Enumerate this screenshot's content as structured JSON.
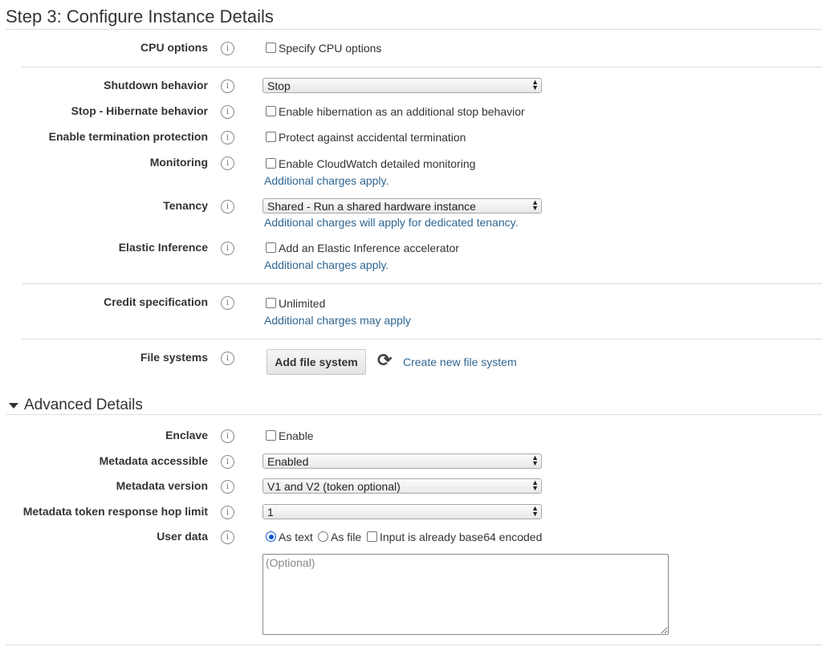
{
  "page_title": "Step 3: Configure Instance Details",
  "info_glyph": "i",
  "fields": {
    "cpu_options": {
      "label": "CPU options",
      "checkbox": "Specify CPU options"
    },
    "shutdown": {
      "label": "Shutdown behavior",
      "value": "Stop"
    },
    "hibernate": {
      "label": "Stop - Hibernate behavior",
      "checkbox": "Enable hibernation as an additional stop behavior"
    },
    "termination": {
      "label": "Enable termination protection",
      "checkbox": "Protect against accidental termination"
    },
    "monitoring": {
      "label": "Monitoring",
      "checkbox": "Enable CloudWatch detailed monitoring",
      "link": "Additional charges apply."
    },
    "tenancy": {
      "label": "Tenancy",
      "value": "Shared - Run a shared hardware instance",
      "link": "Additional charges will apply for dedicated tenancy."
    },
    "elastic": {
      "label": "Elastic Inference",
      "checkbox": "Add an Elastic Inference accelerator",
      "link": "Additional charges apply."
    },
    "credit": {
      "label": "Credit specification",
      "checkbox": "Unlimited",
      "link": "Additional charges may apply"
    },
    "file_systems": {
      "label": "File systems",
      "button": "Add file system",
      "refresh_glyph": "⟳",
      "link": "Create new file system"
    }
  },
  "advanced": {
    "heading": "Advanced Details",
    "enclave": {
      "label": "Enclave",
      "checkbox": "Enable"
    },
    "metadata_accessible": {
      "label": "Metadata accessible",
      "value": "Enabled"
    },
    "metadata_version": {
      "label": "Metadata version",
      "value": "V1 and V2 (token optional)"
    },
    "hop_limit": {
      "label": "Metadata token response hop limit",
      "value": "1"
    },
    "user_data": {
      "label": "User data",
      "as_text": "As text",
      "as_file": "As file",
      "base64": "Input is already base64 encoded",
      "placeholder": "(Optional)",
      "selected": "As text"
    }
  },
  "colors": {
    "link": "#2f6692",
    "text": "#333333",
    "divider": "#dddddd"
  }
}
